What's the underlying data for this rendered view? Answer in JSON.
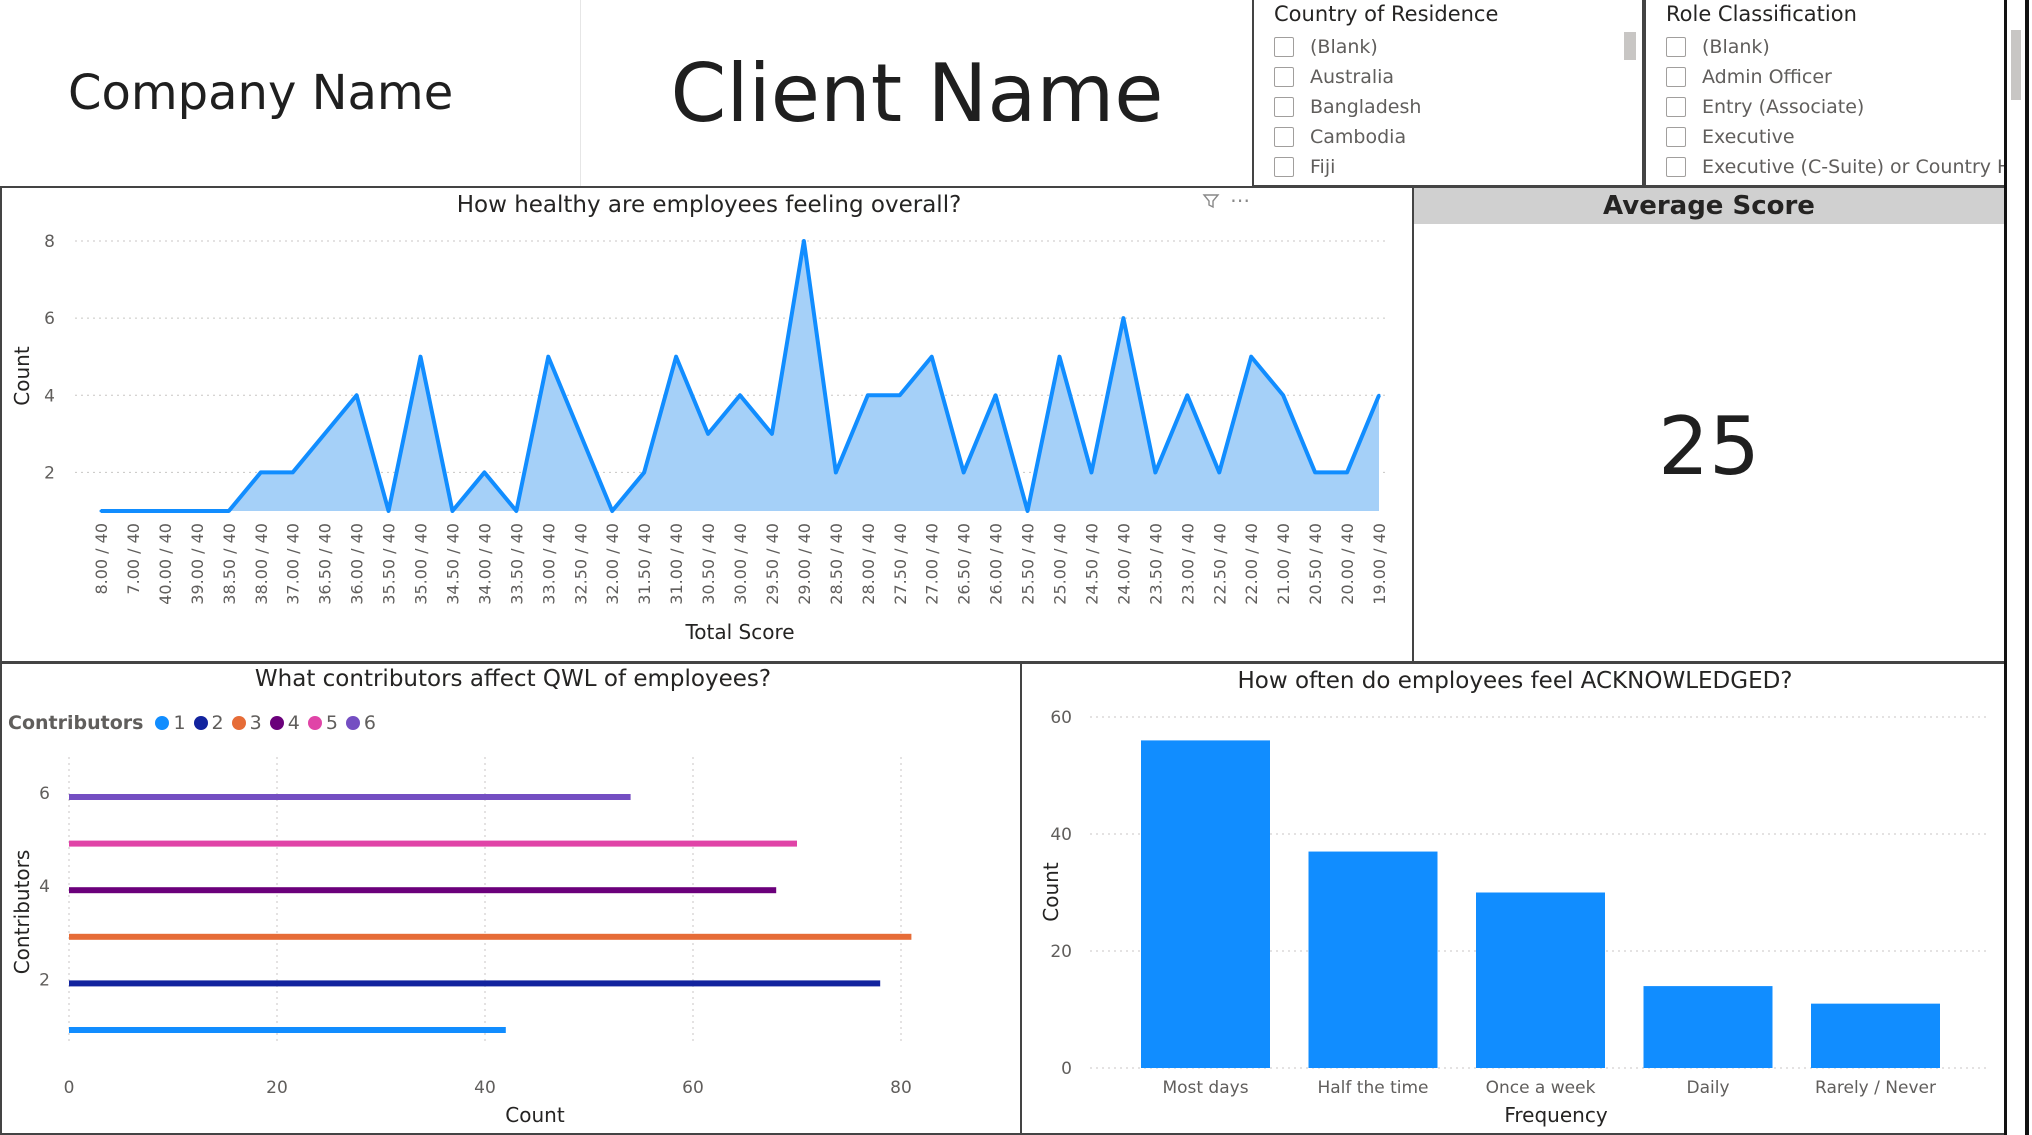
{
  "header": {
    "company": "Company Name",
    "client": "Client Name"
  },
  "slicers": {
    "country": {
      "title": "Country of Residence",
      "items": [
        "(Blank)",
        "Australia",
        "Bangladesh",
        "Cambodia",
        "Fiji"
      ]
    },
    "role": {
      "title": "Role Classification",
      "items": [
        "(Blank)",
        "Admin Officer",
        "Entry (Associate)",
        "Executive",
        "Executive (C-Suite) or Country H..."
      ]
    }
  },
  "kpi": {
    "title": "Average Score",
    "value": "25"
  },
  "colors": {
    "accent": "#118DFF",
    "area_fill": "#A5D0F8",
    "series": [
      "#118DFF",
      "#12239E",
      "#E66C37",
      "#6B007B",
      "#E044A7",
      "#744EC2"
    ]
  },
  "icons": [
    "filter-icon",
    "more-options-icon"
  ],
  "chart_data": [
    {
      "type": "area",
      "title": "How healthy are employees feeling overall?",
      "xlabel": "Total Score",
      "ylabel": "Count",
      "categories": [
        "8.00 / 40",
        "7.00 / 40",
        "40.00 / 40",
        "39.00 / 40",
        "38.50 / 40",
        "38.00 / 40",
        "37.00 / 40",
        "36.50 / 40",
        "36.00 / 40",
        "35.50 / 40",
        "35.00 / 40",
        "34.50 / 40",
        "34.00 / 40",
        "33.50 / 40",
        "33.00 / 40",
        "32.50 / 40",
        "32.00 / 40",
        "31.50 / 40",
        "31.00 / 40",
        "30.50 / 40",
        "30.00 / 40",
        "29.50 / 40",
        "29.00 / 40",
        "28.50 / 40",
        "28.00 / 40",
        "27.50 / 40",
        "27.00 / 40",
        "26.50 / 40",
        "26.00 / 40",
        "25.50 / 40",
        "25.00 / 40",
        "24.50 / 40",
        "24.00 / 40",
        "23.50 / 40",
        "23.00 / 40",
        "22.50 / 40",
        "22.00 / 40",
        "21.00 / 40",
        "20.50 / 40",
        "20.00 / 40",
        "19.00 / 40"
      ],
      "values": [
        1,
        1,
        1,
        1,
        1,
        2,
        2,
        3,
        4,
        1,
        5,
        1,
        2,
        1,
        5,
        3,
        1,
        2,
        5,
        3,
        4,
        3,
        8,
        2,
        4,
        4,
        5,
        2,
        4,
        1,
        5,
        2,
        6,
        2,
        4,
        2,
        5,
        4,
        2,
        2,
        4
      ],
      "ylim": [
        1,
        8
      ],
      "yticks": [
        2,
        4,
        6,
        8
      ],
      "grid": true
    },
    {
      "type": "bar",
      "orientation": "horizontal",
      "title": "What contributors affect QWL of employees?",
      "xlabel": "Count",
      "ylabel": "Contributors",
      "legend_title": "Contributors",
      "legend_placement": "top-left",
      "categories": [
        "1",
        "2",
        "3",
        "4",
        "5",
        "6"
      ],
      "values": [
        42,
        78,
        81,
        68,
        70,
        54
      ],
      "xlim": [
        0,
        80
      ],
      "xticks": [
        0,
        20,
        40,
        60,
        80
      ],
      "yticks": [
        2,
        4,
        6
      ],
      "grid": true
    },
    {
      "type": "bar",
      "title": "How often do employees feel ACKNOWLEDGED?",
      "xlabel": "Frequency",
      "ylabel": "Count",
      "categories": [
        "Most days",
        "Half the time",
        "Once a week",
        "Daily",
        "Rarely / Never"
      ],
      "values": [
        56,
        37,
        30,
        14,
        11
      ],
      "ylim": [
        0,
        60
      ],
      "yticks": [
        0,
        20,
        40,
        60
      ],
      "grid": true
    }
  ]
}
